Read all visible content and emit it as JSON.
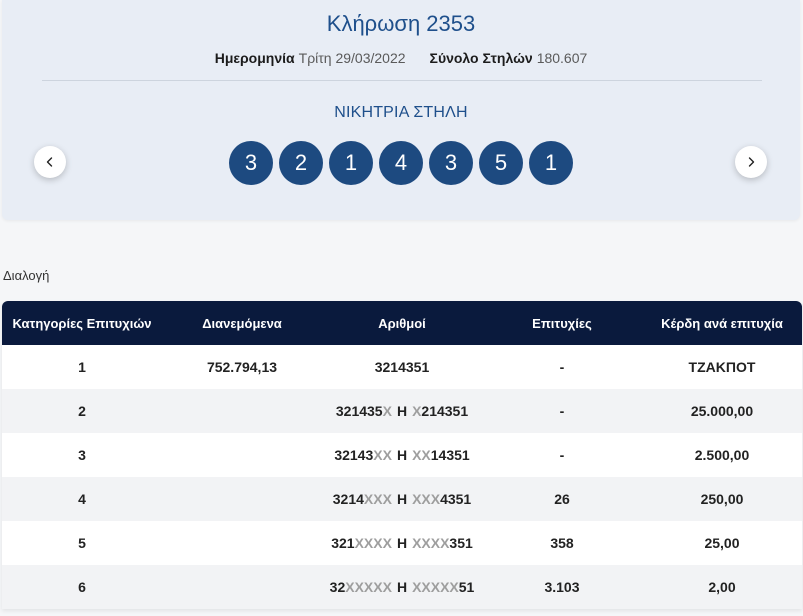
{
  "draw": {
    "title": "Κλήρωση 2353",
    "date_label": "Ημερομηνία",
    "date_value": "Τρίτη 29/03/2022",
    "columns_label": "Σύνολο Στηλών",
    "columns_value": "180.607",
    "winning_label": "ΝΙΚΗΤΡΙΑ ΣΤΗΛΗ",
    "winning_numbers": [
      "3",
      "2",
      "1",
      "4",
      "3",
      "5",
      "1"
    ],
    "prev_icon": "chevron-left-icon",
    "next_icon": "chevron-right-icon"
  },
  "section_title": "Διαλογή",
  "table": {
    "headers": [
      "Κατηγορίες Επιτυχιών",
      "Διανεμόμενα",
      "Αριθμοί",
      "Επιτυχίες",
      "Κέρδη ανά επιτυχία"
    ],
    "rows": [
      {
        "category": "1",
        "distributed": "752.794,13",
        "numbers": {
          "left": "3214351"
        },
        "successes": "-",
        "prize": "ΤΖΑΚΠΟΤ"
      },
      {
        "category": "2",
        "distributed": "",
        "numbers": {
          "left": "321435",
          "left_mask": "X",
          "sep": "Η",
          "right_mask": "X",
          "right": "214351"
        },
        "successes": "-",
        "prize": "25.000,00"
      },
      {
        "category": "3",
        "distributed": "",
        "numbers": {
          "left": "32143",
          "left_mask": "XX",
          "sep": "Η",
          "right_mask": "XX",
          "right": "14351"
        },
        "successes": "-",
        "prize": "2.500,00"
      },
      {
        "category": "4",
        "distributed": "",
        "numbers": {
          "left": "3214",
          "left_mask": "XXX",
          "sep": "Η",
          "right_mask": "XXX",
          "right": "4351"
        },
        "successes": "26",
        "prize": "250,00"
      },
      {
        "category": "5",
        "distributed": "",
        "numbers": {
          "left": "321",
          "left_mask": "XXXX",
          "sep": "Η",
          "right_mask": "XXXX",
          "right": "351"
        },
        "successes": "358",
        "prize": "25,00"
      },
      {
        "category": "6",
        "distributed": "",
        "numbers": {
          "left": "32",
          "left_mask": "XXXXX",
          "sep": "Η",
          "right_mask": "XXXXX",
          "right": "51"
        },
        "successes": "3.103",
        "prize": "2,00"
      }
    ]
  },
  "colors": {
    "accent": "#1d4a80",
    "title": "#1e4f8b",
    "header_bg": "#0a1a3d",
    "panel_bg": "#e8edf5",
    "masked": "#9e9e9e",
    "row_alt": "#f2f3f5"
  }
}
